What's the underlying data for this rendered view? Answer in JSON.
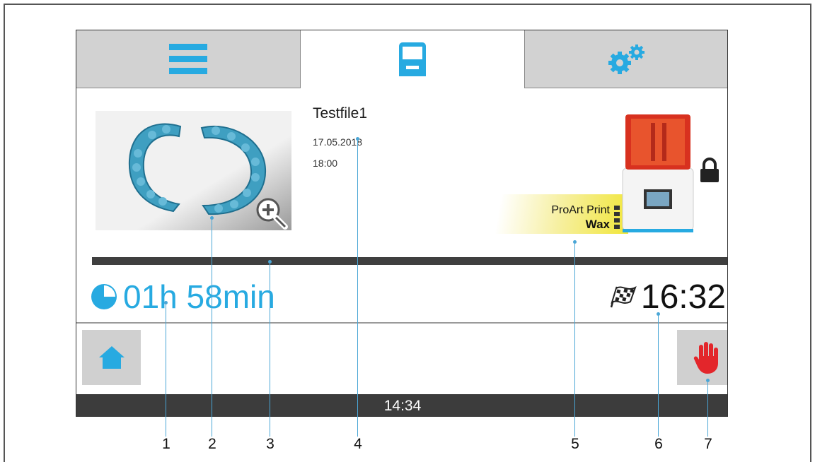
{
  "tabs": [
    {
      "name": "menu",
      "icon": "hamburger-menu-icon",
      "active": false
    },
    {
      "name": "printer",
      "icon": "printer-icon",
      "active": true
    },
    {
      "name": "settings",
      "icon": "gears-icon",
      "active": false
    }
  ],
  "job": {
    "file_name": "Testfile1",
    "date": "17.05.2018",
    "time": "18:00",
    "thumbnail_icon": "dental-model-preview",
    "zoom_icon": "zoom-in-icon"
  },
  "material": {
    "brand": "ProArt Print",
    "type": "Wax",
    "level_icon": "material-level-icon"
  },
  "printer": {
    "image_icon": "printer-device-image",
    "lock_icon": "lock-icon"
  },
  "progress": {
    "percent": 100
  },
  "remaining_time": "01h 58min",
  "finish_time": "16:32",
  "buttons": {
    "home_icon": "home-icon",
    "stop_icon": "hand-stop-icon"
  },
  "status_bar": {
    "clock": "14:34"
  },
  "callouts": [
    "1",
    "2",
    "3",
    "4",
    "5",
    "6",
    "7"
  ],
  "colors": {
    "accent": "#27aae1",
    "stop_red": "#e3262b",
    "status_bar": "#3c3c3c",
    "tab_inactive": "#d2d2d2"
  }
}
